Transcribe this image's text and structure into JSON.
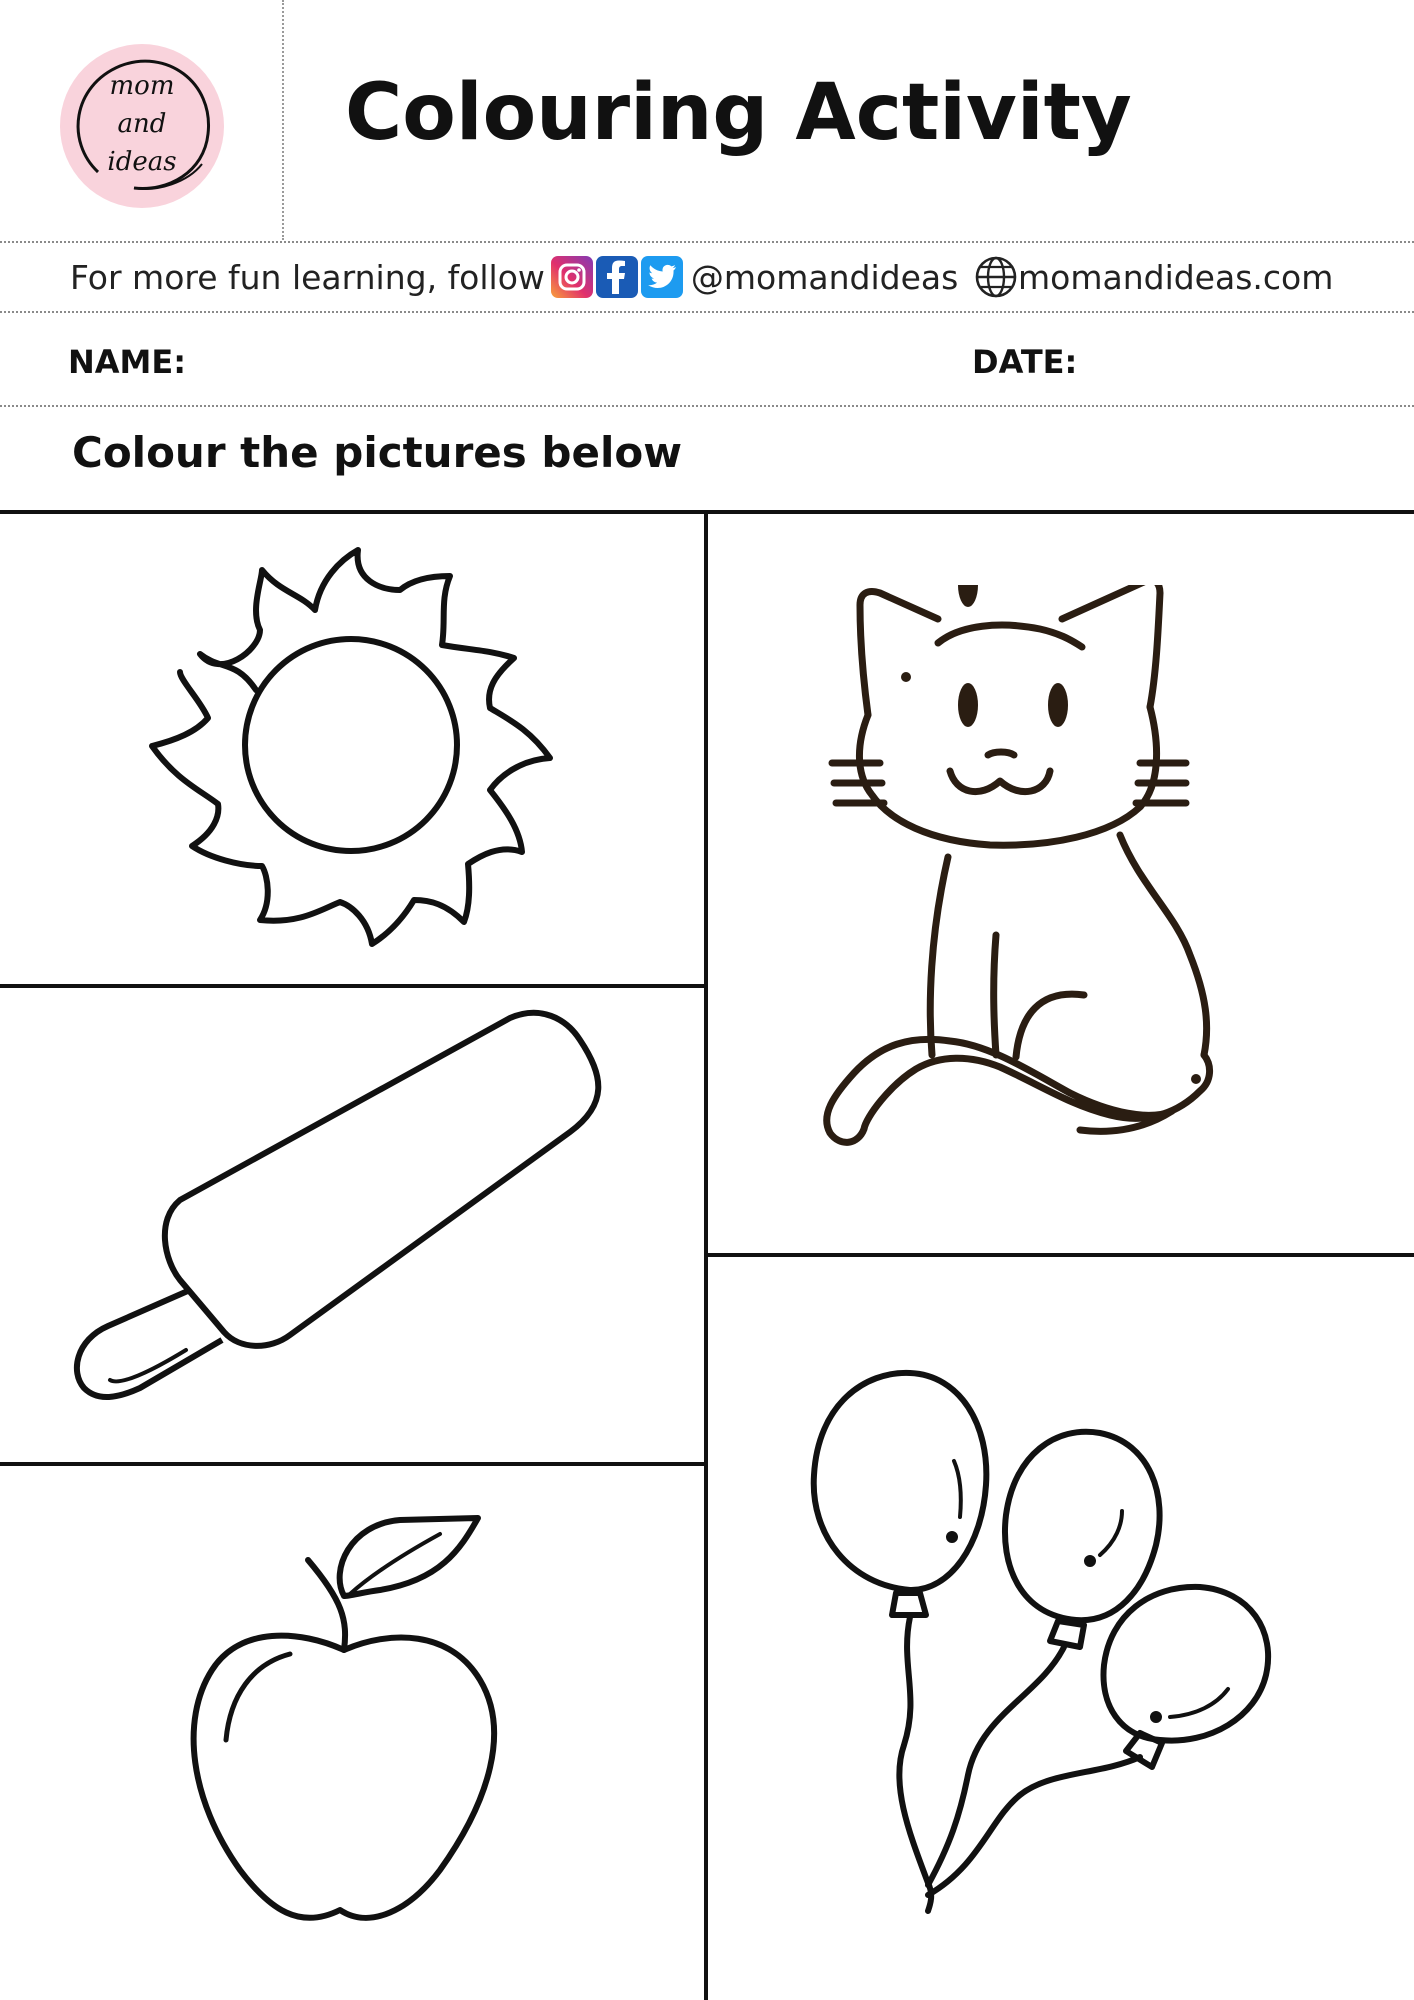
{
  "logo": {
    "line1": "mom",
    "line2": "and",
    "line3": "ideas"
  },
  "title": "Colouring Activity",
  "follow": {
    "text": "For more fun learning, follow",
    "handle": "@momandideas",
    "website": "momandideas.com"
  },
  "fields": {
    "name_label": "NAME:",
    "date_label": "DATE:"
  },
  "instruction": "Colour the pictures below",
  "pictures": [
    "sun",
    "ice lolly",
    "apple",
    "cat",
    "balloons"
  ],
  "colors": {
    "logo_circle": "#f9d3dc",
    "line": "#111111",
    "cat_line": "#2a1d12"
  }
}
